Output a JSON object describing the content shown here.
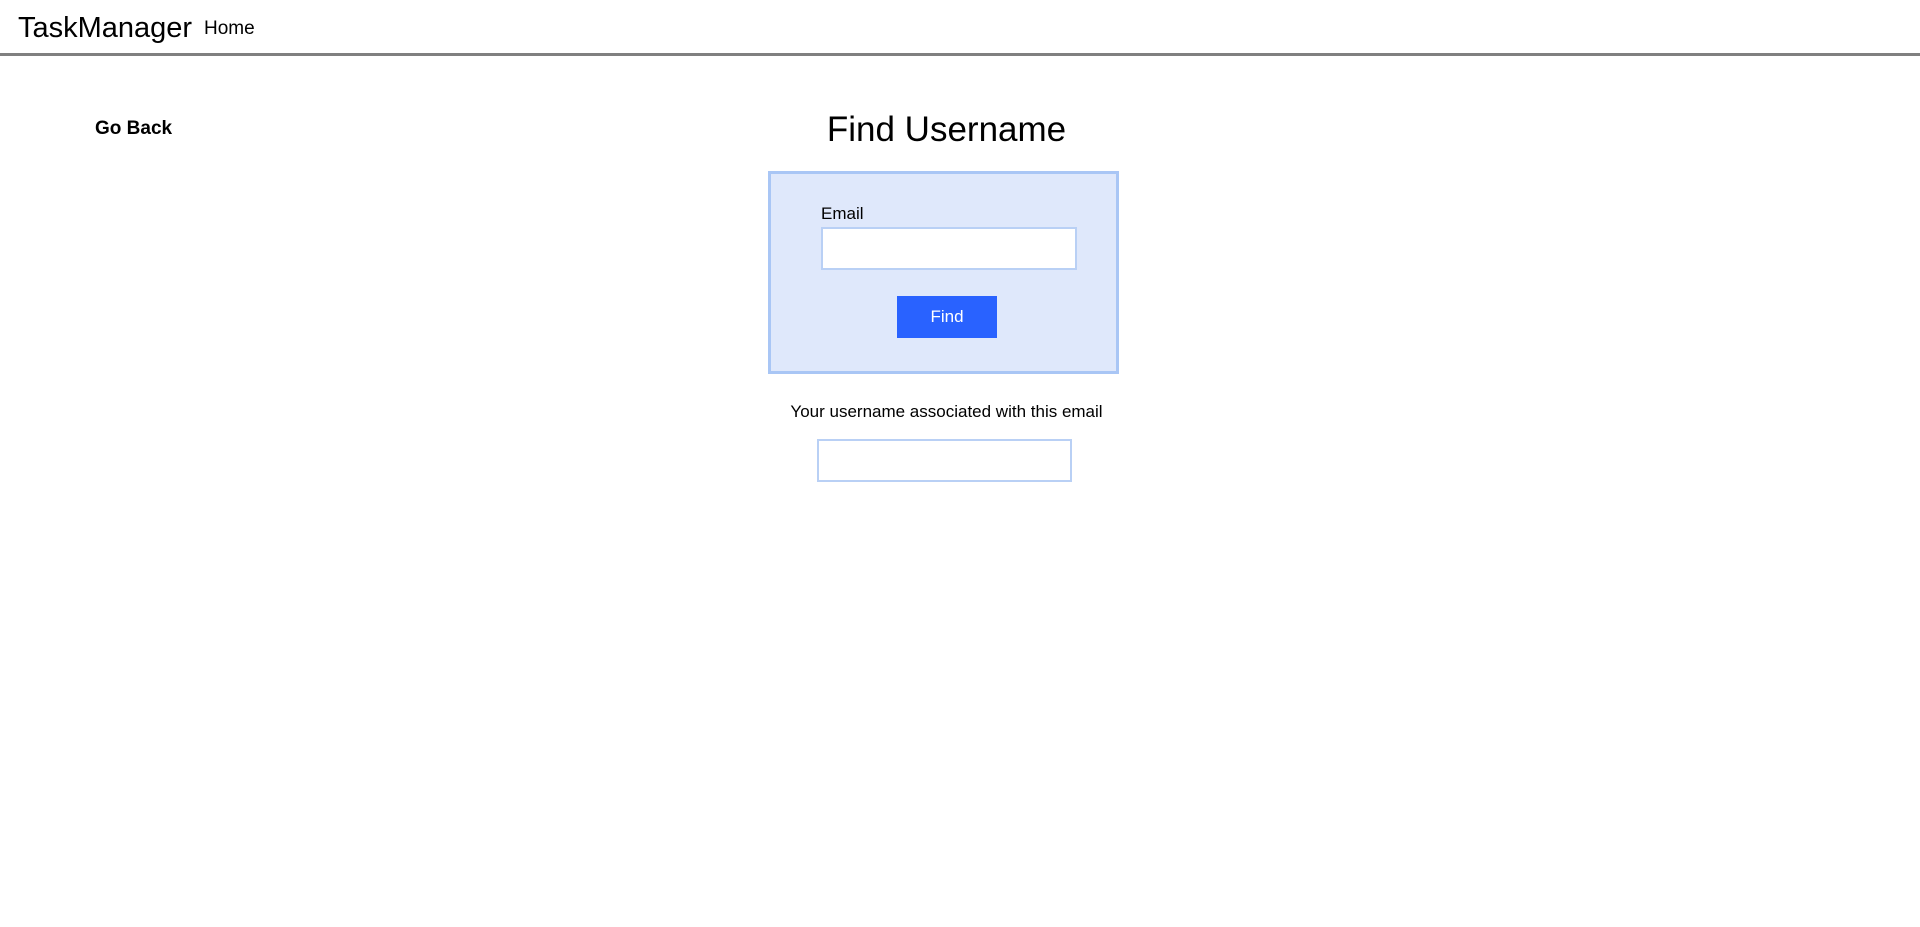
{
  "navbar": {
    "brand": "TaskManager",
    "home_link": "Home"
  },
  "page": {
    "go_back": "Go Back",
    "title": "Find Username"
  },
  "form": {
    "email_label": "Email",
    "email_value": "",
    "find_button": "Find"
  },
  "result": {
    "label": "Your username associated with this email",
    "value": ""
  },
  "colors": {
    "accent": "#2962ff",
    "form_background": "#dfe8fb",
    "form_border": "#a9c6f5",
    "navbar_border": "#808080"
  }
}
